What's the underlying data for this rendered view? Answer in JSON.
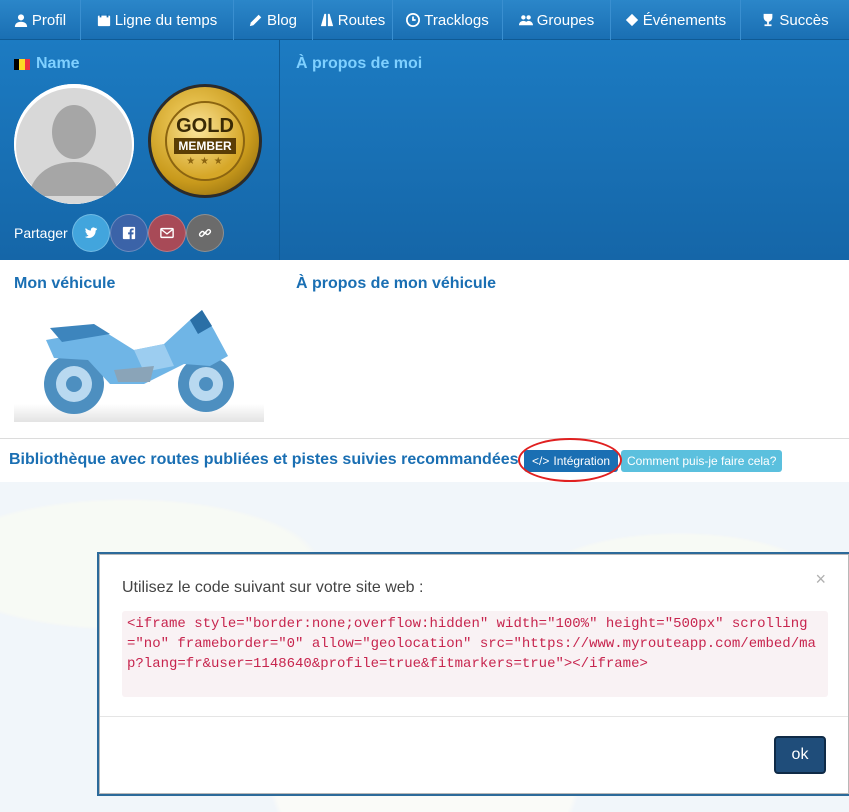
{
  "nav": {
    "items": [
      {
        "label": "Profil",
        "icon": "user-icon"
      },
      {
        "label": "Ligne du temps",
        "icon": "calendar-icon"
      },
      {
        "label": "Blog",
        "icon": "pencil-icon"
      },
      {
        "label": "Routes",
        "icon": "road-icon"
      },
      {
        "label": "Tracklogs",
        "icon": "clock-icon"
      },
      {
        "label": "Groupes",
        "icon": "users-icon"
      },
      {
        "label": "Événements",
        "icon": "ticket-icon"
      },
      {
        "label": "Succès",
        "icon": "trophy-icon"
      }
    ]
  },
  "profile": {
    "name": "Name",
    "about_title": "À propos de moi",
    "badge": {
      "top": "GOLD",
      "bottom": "MEMBER",
      "stars": "★ ★ ★"
    },
    "share_label": "Partager",
    "share_buttons": [
      {
        "name": "twitter",
        "color": "#1da1f2"
      },
      {
        "name": "facebook",
        "color": "#3b5998"
      },
      {
        "name": "email",
        "color": "#b04c4c"
      },
      {
        "name": "link",
        "color": "#6d6d6d"
      }
    ],
    "flag_colors": [
      "#000000",
      "#fdda24",
      "#ef3340"
    ]
  },
  "vehicle": {
    "title": "Mon véhicule",
    "about_title": "À propos de mon véhicule"
  },
  "library": {
    "title": "Bibliothèque avec routes publiées et pistes suivies recommandées",
    "integration_label": "Intégration",
    "help_label": "Comment puis-je faire cela?"
  },
  "modal": {
    "title": "Utilisez le code suivant sur votre site web :",
    "close": "×",
    "code": "<iframe style=\"border:none;overflow:hidden\" width=\"100%\" height=\"500px\" scrolling=\"no\" frameborder=\"0\" allow=\"geolocation\" src=\"https://www.myrouteapp.com/embed/map?lang=fr&user=1148640&profile=true&fitmarkers=true\"></iframe>",
    "ok_label": "ok"
  },
  "colors": {
    "nav_bg": "#1a6fb3",
    "profile_bg": "#1566a8",
    "heading_light": "#7fd0ff",
    "heading_blue": "#1a6fb3",
    "annotation_red": "#e02020"
  }
}
